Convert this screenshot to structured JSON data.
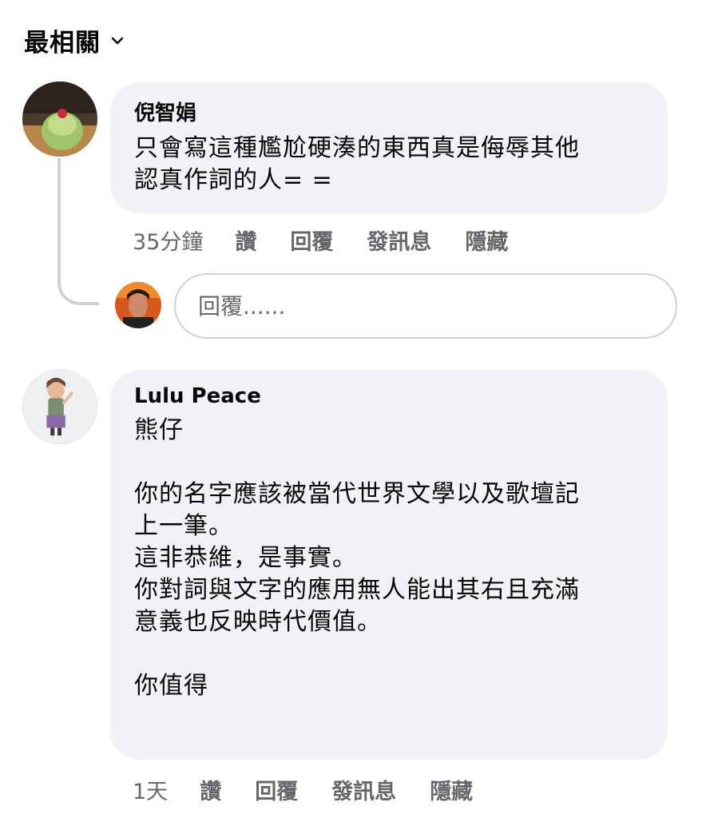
{
  "sort": {
    "label": "最相關",
    "icon": "chevron-down-icon"
  },
  "comments": [
    {
      "author": "倪智娟",
      "text": "只會寫這種尷尬硬湊的東西真是侮辱其他\n認真作詞的人= =",
      "time": "35分鐘",
      "actions": [
        "讚",
        "回覆",
        "發訊息",
        "隱藏"
      ]
    },
    {
      "author": "Lulu Peace",
      "text": "熊仔\n\n你的名字應該被當代世界文學以及歌壇記\n上一筆。\n這非恭維，是事實。\n你對詞與文字的應用無人能出其右且充滿\n意義也反映時代價值。\n\n你值得",
      "time": "1天",
      "actions": [
        "讚",
        "回覆",
        "發訊息",
        "隱藏"
      ]
    }
  ],
  "reply": {
    "placeholder": "回覆......"
  },
  "colors": {
    "bubble": "#f0f2f5",
    "meta": "#65676b",
    "border": "#ced0d4"
  }
}
